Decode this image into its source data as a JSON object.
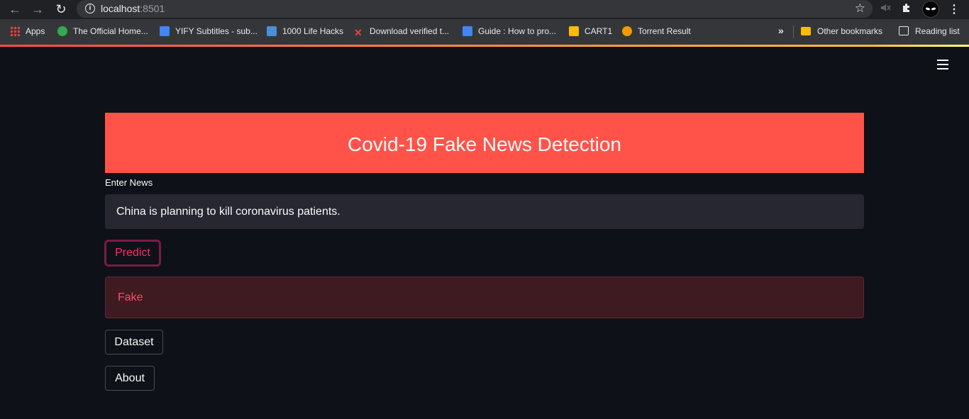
{
  "browser": {
    "url_host": "localhost",
    "url_port": ":8501",
    "back_icon": "←",
    "forward_icon": "→",
    "reload_icon": "↻",
    "info_icon": "i",
    "star_icon": "☆",
    "more_icon": "⋮"
  },
  "bookmarks": {
    "items": [
      {
        "label": "Apps",
        "icon": "apps-grid-icon"
      },
      {
        "label": "The Official Home...",
        "icon": "site-icon",
        "color": "#34a853"
      },
      {
        "label": "YIFY Subtitles - sub...",
        "icon": "yify-icon",
        "color": "#4285f4"
      },
      {
        "label": "1000 Life Hacks",
        "icon": "lifehacks-icon",
        "color": "#4a90d9"
      },
      {
        "label": "Download verified t...",
        "icon": "x-icon",
        "color": "#ea4335"
      },
      {
        "label": "Guide : How to pro...",
        "icon": "docs-icon",
        "color": "#4285f4"
      },
      {
        "label": "CART1",
        "icon": "cart-icon",
        "color": "#fbbc04"
      },
      {
        "label": "Torrent Result",
        "icon": "torrent-icon",
        "color": "#f29900"
      }
    ],
    "overflow_label": "»",
    "other_label": "Other bookmarks",
    "reading_label": "Reading list"
  },
  "app": {
    "title": "Covid-19 Fake News Detection",
    "input_label": "Enter News",
    "input_value": "China is planning to kill coronavirus patients.",
    "predict_label": "Predict",
    "result_label": "Fake",
    "dataset_label": "Dataset",
    "about_label": "About"
  },
  "colors": {
    "background": "#0e1117",
    "title_banner": "#ff5349",
    "predict_border": "#7a1b48",
    "predict_text": "#ff2b6b",
    "result_bg": "#3e1a21",
    "result_text": "#ff4b6e"
  }
}
